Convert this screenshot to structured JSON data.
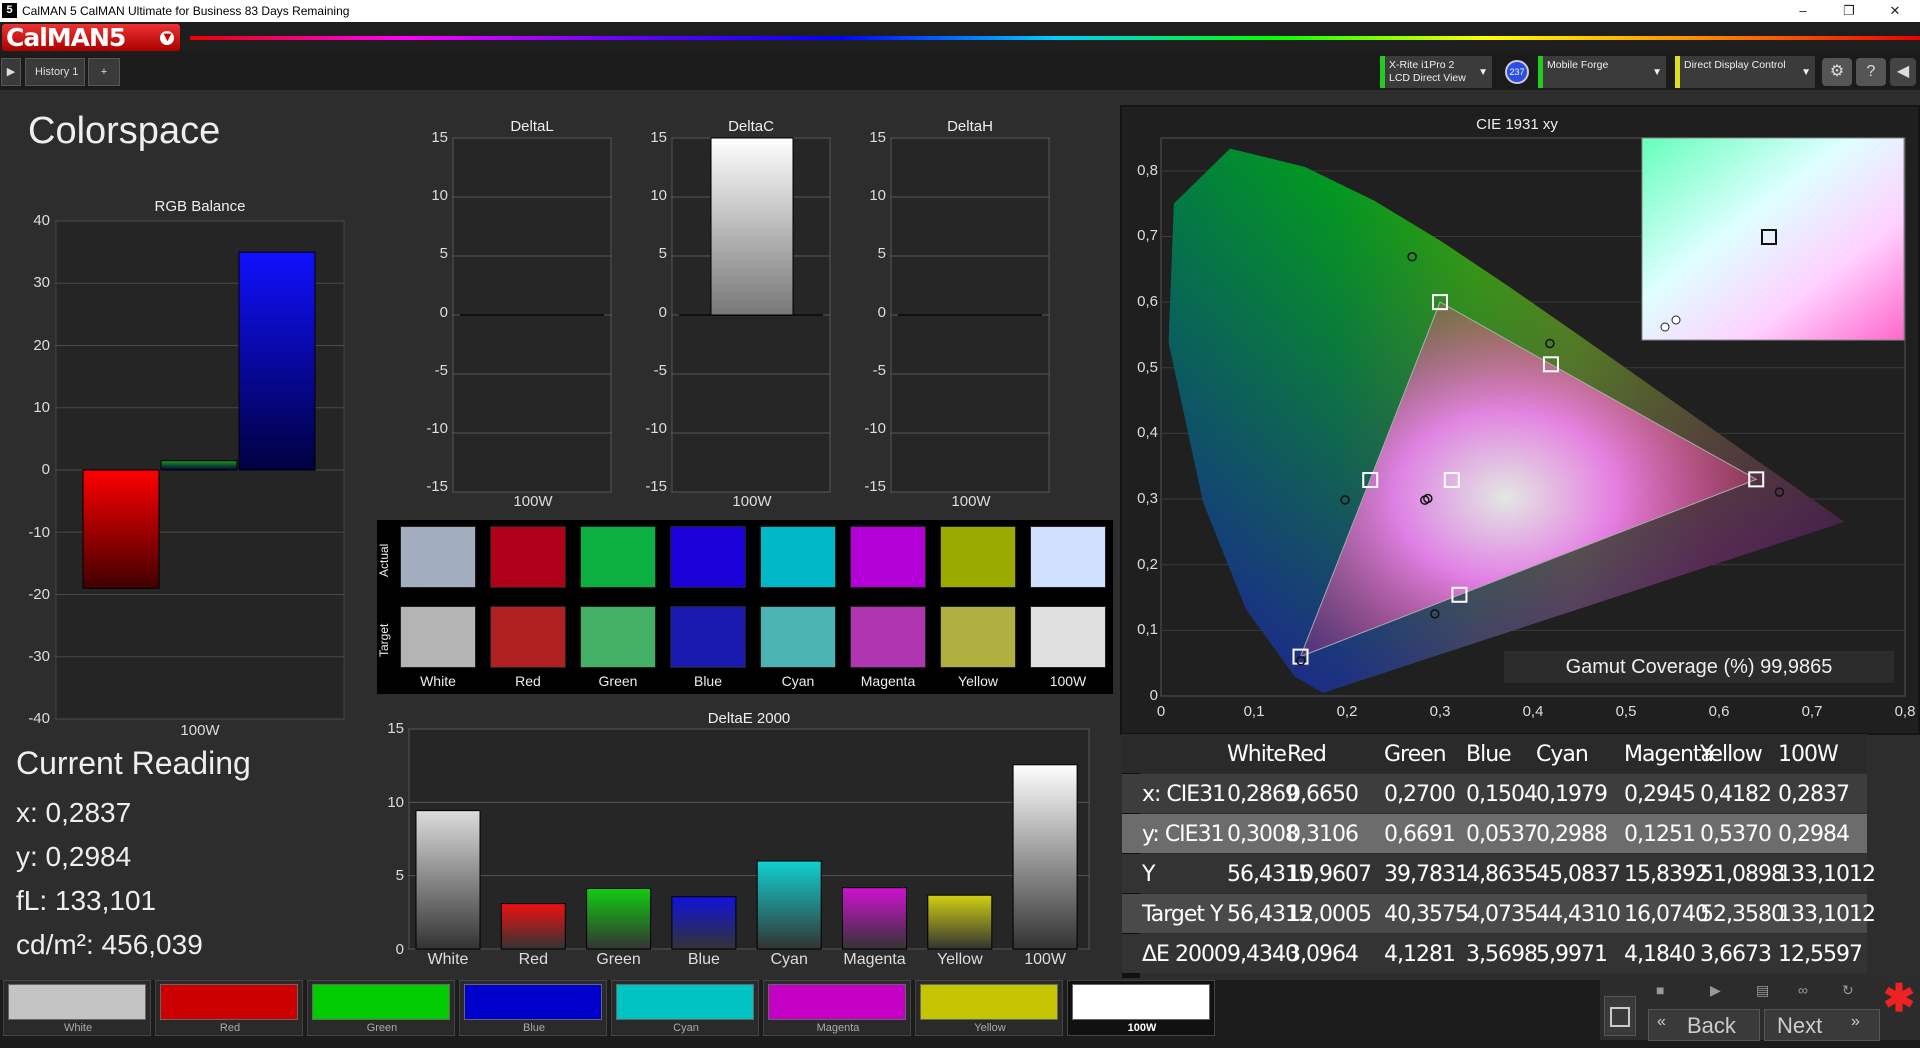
{
  "window": {
    "app_icon": "5",
    "title": "CalMAN 5 CalMAN Ultimate for Business 83 Days Remaining",
    "min": "–",
    "max": "❐",
    "close": "✕"
  },
  "logo": "CalMAN5",
  "tabs": {
    "history": "History 1",
    "add": "+",
    "play": "▶"
  },
  "devices": {
    "meter_line1": "X-Rite i1Pro 2",
    "meter_line2": "LCD Direct View",
    "badge": "237",
    "source": "Mobile Forge",
    "display": "Direct Display Control"
  },
  "page_title": "Colorspace",
  "rgb_balance": {
    "title": "RGB Balance",
    "xlabel": "100W",
    "yticks": [
      "40",
      "30",
      "20",
      "10",
      "0",
      "-10",
      "-20",
      "-30",
      "-40"
    ]
  },
  "delta_small": {
    "l_title": "DeltaL",
    "c_title": "DeltaC",
    "h_title": "DeltaH",
    "xlabel": "100W",
    "yticks": [
      "15",
      "10",
      "5",
      "0",
      "-5",
      "-10",
      "-15"
    ]
  },
  "swatches": {
    "actual_label": "Actual",
    "target_label": "Target",
    "names": [
      "White",
      "Red",
      "Green",
      "Blue",
      "Cyan",
      "Magenta",
      "Yellow",
      "100W"
    ],
    "actual_colors": [
      "#a3adc0",
      "#b0001a",
      "#0bb040",
      "#1b00d8",
      "#00b8c8",
      "#b200d6",
      "#9aaa00",
      "#cfe0ff"
    ],
    "target_colors": [
      "#b4b4b4",
      "#b02020",
      "#44b066",
      "#1a1ab0",
      "#4db4b4",
      "#b035b0",
      "#b0b040",
      "#e0e0e0"
    ]
  },
  "deltae_title": "DeltaE 2000",
  "deltae_yticks": [
    "15",
    "10",
    "5",
    "0"
  ],
  "cie": {
    "title": "CIE 1931 xy",
    "gamut_label": "Gamut Coverage (%) 99,9865",
    "xticks": [
      "0",
      "0,1",
      "0,2",
      "0,3",
      "0,4",
      "0,5",
      "0,6",
      "0,7",
      "0,8"
    ],
    "yticks": [
      "0,8",
      "0,7",
      "0,6",
      "0,5",
      "0,4",
      "0,3",
      "0,2",
      "0,1",
      "0"
    ]
  },
  "current_reading": {
    "title": "Current Reading",
    "x": "x: 0,2837",
    "y": "y: 0,2984",
    "fl": "fL: 133,101",
    "cdm2": "cd/m²: 456,039"
  },
  "table": {
    "headers": [
      "White",
      "Red",
      "Green",
      "Blue",
      "Cyan",
      "Magenta",
      "Yellow",
      "100W"
    ],
    "rows": [
      {
        "label": "x: CIE31",
        "values": [
          "0,2869",
          "0,6650",
          "0,2700",
          "0,1504",
          "0,1979",
          "0,2945",
          "0,4182",
          "0,2837"
        ]
      },
      {
        "label": "y: CIE31",
        "values": [
          "0,3008",
          "0,3106",
          "0,6691",
          "0,0537",
          "0,2988",
          "0,1251",
          "0,5370",
          "0,2984"
        ]
      },
      {
        "label": "Y",
        "values": [
          "56,4315",
          "10,9607",
          "39,7831",
          "4,8635",
          "45,0837",
          "15,8392",
          "51,0898",
          "133,1012"
        ]
      },
      {
        "label": "Target Y",
        "values": [
          "56,4315",
          "12,0005",
          "40,3575",
          "4,0735",
          "44,4310",
          "16,0740",
          "52,3580",
          "133,1012"
        ]
      },
      {
        "label": "ΔE 2000",
        "values": [
          "9,4340",
          "3,0964",
          "4,1281",
          "3,5698",
          "5,9971",
          "4,1840",
          "3,6673",
          "12,5597"
        ]
      }
    ]
  },
  "patches": [
    {
      "label": "White",
      "color": "#c4c4c4"
    },
    {
      "label": "Red",
      "color": "#cc0000"
    },
    {
      "label": "Green",
      "color": "#00cc00"
    },
    {
      "label": "Blue",
      "color": "#0000cc"
    },
    {
      "label": "Cyan",
      "color": "#00c4c4"
    },
    {
      "label": "Magenta",
      "color": "#c400c4"
    },
    {
      "label": "Yellow",
      "color": "#c4c400"
    },
    {
      "label": "100W",
      "color": "#ffffff"
    }
  ],
  "nav": {
    "back": "Back",
    "next": "Next"
  },
  "chart_data": [
    {
      "type": "bar",
      "title": "RGB Balance",
      "categories": [
        "100W"
      ],
      "series": [
        {
          "name": "Red",
          "values": [
            -19
          ],
          "color": "#ff0000"
        },
        {
          "name": "Green",
          "values": [
            1.5
          ],
          "color": "#1a9a1a"
        },
        {
          "name": "Blue",
          "values": [
            35
          ],
          "color": "#1010ff"
        }
      ],
      "ylim": [
        -40,
        40
      ]
    },
    {
      "type": "bar",
      "title": "DeltaL",
      "categories": [
        "100W"
      ],
      "values": [
        0
      ],
      "ylim": [
        -15,
        15
      ]
    },
    {
      "type": "bar",
      "title": "DeltaC",
      "categories": [
        "100W"
      ],
      "values": [
        15
      ],
      "ylim": [
        -15,
        15
      ]
    },
    {
      "type": "bar",
      "title": "DeltaH",
      "categories": [
        "100W"
      ],
      "values": [
        0
      ],
      "ylim": [
        -15,
        15
      ]
    },
    {
      "type": "bar",
      "title": "DeltaE 2000",
      "categories": [
        "White",
        "Red",
        "Green",
        "Blue",
        "Cyan",
        "Magenta",
        "Yellow",
        "100W"
      ],
      "values": [
        9.434,
        3.0964,
        4.1281,
        3.5698,
        5.9971,
        4.184,
        3.6673,
        12.5597
      ],
      "colors": [
        "#dcdcdc",
        "#ee1111",
        "#11cc11",
        "#1111dd",
        "#11d0d0",
        "#d011d0",
        "#d0d011",
        "#ffffff"
      ],
      "ylim": [
        0,
        15
      ]
    },
    {
      "type": "scatter",
      "title": "CIE 1931 xy",
      "xlim": [
        0,
        0.8
      ],
      "ylim": [
        0,
        0.85
      ],
      "targets": [
        [
          0.64,
          0.33
        ],
        [
          0.3,
          0.6
        ],
        [
          0.15,
          0.06
        ],
        [
          0.3127,
          0.329
        ],
        [
          0.225,
          0.329
        ],
        [
          0.4193,
          0.5053
        ],
        [
          0.3209,
          0.1542
        ]
      ],
      "measured": [
        [
          0.665,
          0.3106
        ],
        [
          0.27,
          0.6691
        ],
        [
          0.1504,
          0.0537
        ],
        [
          0.2837,
          0.2984
        ],
        [
          0.1979,
          0.2988
        ],
        [
          0.2945,
          0.1251
        ],
        [
          0.4182,
          0.537
        ],
        [
          0.2869,
          0.3008
        ]
      ]
    }
  ]
}
